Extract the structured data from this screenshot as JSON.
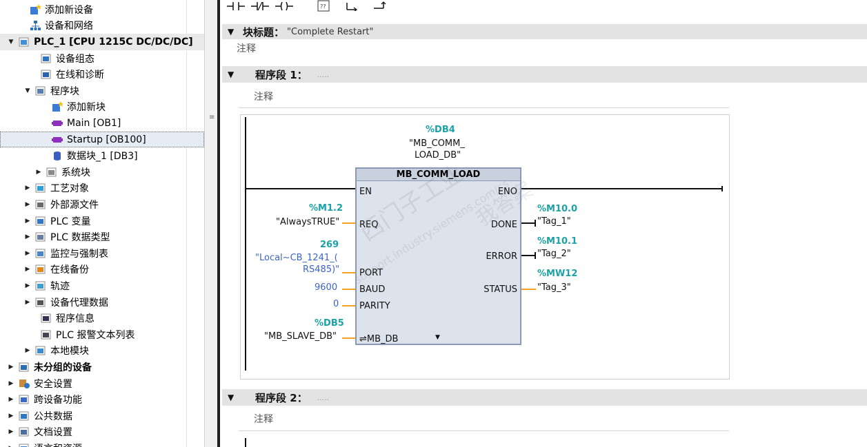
{
  "tree": {
    "items": [
      {
        "label": "添加新设备",
        "icon": "add-device-icon",
        "arrow": "none",
        "indent": 1
      },
      {
        "label": "设备和网络",
        "icon": "network-icon",
        "arrow": "none",
        "indent": 1
      },
      {
        "label": "PLC_1 [CPU 1215C DC/DC/DC]",
        "icon": "plc-icon",
        "arrow": "expanded",
        "indent": 0,
        "bold": true,
        "state": "dim"
      },
      {
        "label": "设备组态",
        "icon": "device-config-icon",
        "arrow": "none",
        "indent": 2
      },
      {
        "label": "在线和诊断",
        "icon": "online-diagnostics-icon",
        "arrow": "none",
        "indent": 2
      },
      {
        "label": "程序块",
        "icon": "program-blocks-icon",
        "arrow": "expanded",
        "indent": 1.5
      },
      {
        "label": "添加新块",
        "icon": "add-block-icon",
        "arrow": "none",
        "indent": 3
      },
      {
        "label": "Main [OB1]",
        "icon": "ob-icon",
        "arrow": "none",
        "indent": 3
      },
      {
        "label": "Startup [OB100]",
        "icon": "ob-icon",
        "arrow": "none",
        "indent": 3,
        "state": "selected"
      },
      {
        "label": "数据块_1 [DB3]",
        "icon": "db-icon",
        "arrow": "none",
        "indent": 3
      },
      {
        "label": "系统块",
        "icon": "system-blocks-icon",
        "arrow": "collapsed",
        "indent": 2.5
      },
      {
        "label": "工艺对象",
        "icon": "technology-objects-icon",
        "arrow": "collapsed",
        "indent": 1.5
      },
      {
        "label": "外部源文件",
        "icon": "external-source-icon",
        "arrow": "collapsed",
        "indent": 1.5
      },
      {
        "label": "PLC 变量",
        "icon": "plc-tags-icon",
        "arrow": "collapsed",
        "indent": 1.5
      },
      {
        "label": "PLC 数据类型",
        "icon": "plc-datatypes-icon",
        "arrow": "collapsed",
        "indent": 1.5
      },
      {
        "label": "监控与强制表",
        "icon": "watch-table-icon",
        "arrow": "collapsed",
        "indent": 1.5
      },
      {
        "label": "在线备份",
        "icon": "online-backup-icon",
        "arrow": "collapsed",
        "indent": 1.5
      },
      {
        "label": "轨迹",
        "icon": "traces-icon",
        "arrow": "collapsed",
        "indent": 1.5
      },
      {
        "label": "设备代理数据",
        "icon": "proxy-data-icon",
        "arrow": "collapsed",
        "indent": 1.5
      },
      {
        "label": "程序信息",
        "icon": "program-info-icon",
        "arrow": "none",
        "indent": 2
      },
      {
        "label": "PLC 报警文本列表",
        "icon": "alarm-text-icon",
        "arrow": "none",
        "indent": 2
      },
      {
        "label": "本地模块",
        "icon": "local-modules-icon",
        "arrow": "collapsed",
        "indent": 1.5
      },
      {
        "label": "未分组的设备",
        "icon": "ungrouped-devices-icon",
        "arrow": "collapsed",
        "indent": 0,
        "bold": true
      },
      {
        "label": "安全设置",
        "icon": "security-icon",
        "arrow": "collapsed",
        "indent": 0
      },
      {
        "label": "跨设备功能",
        "icon": "cross-device-icon",
        "arrow": "collapsed",
        "indent": 0
      },
      {
        "label": "公共数据",
        "icon": "common-data-icon",
        "arrow": "collapsed",
        "indent": 0
      },
      {
        "label": "文档设置",
        "icon": "doc-settings-icon",
        "arrow": "collapsed",
        "indent": 0
      },
      {
        "label": "语言和资源",
        "icon": "languages-icon",
        "arrow": "collapsed",
        "indent": 0
      }
    ]
  },
  "toolbar": {
    "buttons": [
      "no-contact-icon",
      "nc-contact-icon",
      "coil-icon",
      "empty-box-icon",
      "open-branch-icon",
      "close-branch-icon"
    ],
    "empty_box_text": "??"
  },
  "block": {
    "title_label": "块标题：",
    "title_value": "\"Complete Restart\"",
    "comment": "注释"
  },
  "network1": {
    "title": "程序段 1：",
    "dots": ".....",
    "comment": "注释",
    "instance_addr": "%DB4",
    "instance_name_1": "\"MB_COMM_",
    "instance_name_2": "LOAD_DB\"",
    "fb_name": "MB_COMM_LOAD",
    "inputs": {
      "en": "EN",
      "req": "REQ",
      "port": "PORT",
      "baud": "BAUD",
      "parity": "PARITY",
      "mb_db": "⇌MB_DB"
    },
    "outputs": {
      "eno": "ENO",
      "done": "DONE",
      "error": "ERROR",
      "status": "STATUS"
    },
    "req_addr": "%M1.2",
    "req_name": "\"AlwaysTRUE\"",
    "port_value": "269",
    "port_name_1": "\"Local~CB_1241_(",
    "port_name_2": "RS485)\"",
    "baud_value": "9600",
    "parity_value": "0",
    "mbdb_addr": "%DB5",
    "mbdb_name": "\"MB_SLAVE_DB\"",
    "done_addr": "%M10.0",
    "done_name": "\"Tag_1\"",
    "error_addr": "%M10.1",
    "error_name": "\"Tag_2\"",
    "status_addr": "%MW12",
    "status_name": "\"Tag_3\"",
    "expand_icon": "▼"
  },
  "network2": {
    "title": "程序段 2：",
    "dots": ".....",
    "comment": "注释"
  },
  "watermark": {
    "line1": "西门子工业",
    "line2": "support.industry.siemens.com/cs",
    "line3": "我答案"
  },
  "colors": {
    "teal": "#1ba2a7",
    "blue": "#3d63c8",
    "orange": "#f2a21c",
    "fb_fill": "#dde3ec"
  }
}
